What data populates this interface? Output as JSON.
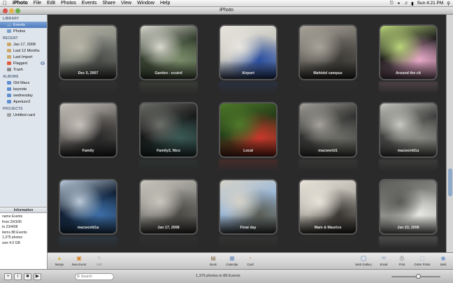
{
  "menubar": {
    "apple": "",
    "app": "iPhoto",
    "items": [
      "File",
      "Edit",
      "Photos",
      "Events",
      "Share",
      "View",
      "Window",
      "Help"
    ],
    "clock": "Sun 4:21 PM"
  },
  "window": {
    "title": "iPhoto"
  },
  "sidebar": {
    "library_header": "LIBRARY",
    "library": [
      {
        "label": "Events",
        "icon": "events-icon",
        "selected": true
      },
      {
        "label": "Photos",
        "icon": "photos-icon",
        "selected": false
      }
    ],
    "recent_header": "RECENT",
    "recent": [
      {
        "label": "Jan 17, 2008",
        "icon": "roll-icon",
        "badge": ""
      },
      {
        "label": "Last 12 Months",
        "icon": "calendar-icon",
        "badge": ""
      },
      {
        "label": "Last Import",
        "icon": "import-icon",
        "badge": ""
      },
      {
        "label": "Flagged",
        "icon": "flag-icon",
        "badge": "0"
      },
      {
        "label": "Trash",
        "icon": "trash-icon",
        "badge": ""
      }
    ],
    "albums_header": "ALBUMS",
    "albums": [
      {
        "label": "Old Macs",
        "icon": "album-icon"
      },
      {
        "label": "keynote",
        "icon": "album-icon"
      },
      {
        "label": "wednesday",
        "icon": "album-icon"
      },
      {
        "label": "Aperture3",
        "icon": "album-icon"
      }
    ],
    "projects_header": "PROJECTS",
    "projects": [
      {
        "label": "Untitled card",
        "icon": "card-icon"
      }
    ]
  },
  "info": {
    "header": "Information",
    "lines": [
      "name Events",
      "from 29/3/05",
      "to 23/4/08",
      "items 88 Events",
      "1,375 photos",
      "size 4.0 GB"
    ]
  },
  "events": [
    {
      "caption": "Dec 5, 2007",
      "palette": [
        "#8c8f86",
        "#4a4d49",
        "#b9b6a8"
      ]
    },
    {
      "caption": "Garden - xcuird",
      "palette": [
        "#2f3a2a",
        "#7a8c6a",
        "#d9d9cf"
      ]
    },
    {
      "caption": "Airport",
      "palette": [
        "#c8c7bf",
        "#2b4fa0",
        "#e8e6df"
      ]
    },
    {
      "caption": "Mahidol campus",
      "palette": [
        "#6d6a63",
        "#3d3b37",
        "#a9a49a"
      ]
    },
    {
      "caption": "Around the cit",
      "palette": [
        "#1b1b1b",
        "#e8a9c8",
        "#b9d47a"
      ]
    },
    {
      "caption": "Family",
      "palette": [
        "#6e6a66",
        "#2a2a2a",
        "#c7c2bb"
      ]
    },
    {
      "caption": "Family2, Nice",
      "palette": [
        "#141414",
        "#3a5a55",
        "#6d6f6a"
      ]
    },
    {
      "caption": "Local",
      "palette": [
        "#233a18",
        "#c8372b",
        "#4f7a2a"
      ]
    },
    {
      "caption": "macworld1",
      "palette": [
        "#2d2d2d",
        "#6b6b66",
        "#a4a29a"
      ]
    },
    {
      "caption": "macworld1a",
      "palette": [
        "#3a3a3a",
        "#8b8b86",
        "#c9c9c2"
      ]
    },
    {
      "caption": "macworld1a",
      "palette": [
        "#0d1b2e",
        "#3d6ea6",
        "#b9c9d9"
      ]
    },
    {
      "caption": "Jan 17, 2008",
      "palette": [
        "#8d8c86",
        "#4c4a46",
        "#c9c6bd"
      ]
    },
    {
      "caption": "Final day",
      "palette": [
        "#9bb8d8",
        "#5a5d55",
        "#d7d3c8"
      ]
    },
    {
      "caption": "Mam & Maurice",
      "palette": [
        "#b7b3aa",
        "#3a3733",
        "#e8e4da"
      ]
    },
    {
      "caption": "Jan 23, 2008",
      "palette": [
        "#8b8b88",
        "#e6e6e2",
        "#5a5a57"
      ]
    }
  ],
  "toolbar": {
    "left": [
      {
        "label": "Merge",
        "icon": "merge-icon",
        "dim": false
      },
      {
        "label": "New Event",
        "icon": "new-event-icon",
        "dim": false
      },
      {
        "label": "Edit",
        "icon": "edit-icon",
        "dim": true
      }
    ],
    "right": [
      {
        "label": "Book",
        "icon": "book-icon"
      },
      {
        "label": "Calendar",
        "icon": "calendar-icon"
      },
      {
        "label": "Card",
        "icon": "card-icon"
      },
      {
        "label": "Web Gallery",
        "icon": "web-gallery-icon"
      },
      {
        "label": "Email",
        "icon": "email-icon"
      },
      {
        "label": "Print",
        "icon": "print-icon"
      },
      {
        "label": "Order Prints",
        "icon": "order-prints-icon"
      },
      {
        "label": "Web",
        "icon": "web-icon"
      }
    ]
  },
  "bottom": {
    "search_placeholder": "Search",
    "count": "1,375 photos in 88 Events",
    "zoom": 0.55
  },
  "colors": {
    "viewer_bg": "#2a2a2a",
    "selection": "#4d7bbd",
    "sidebar_bg": "#dfe5ed"
  }
}
